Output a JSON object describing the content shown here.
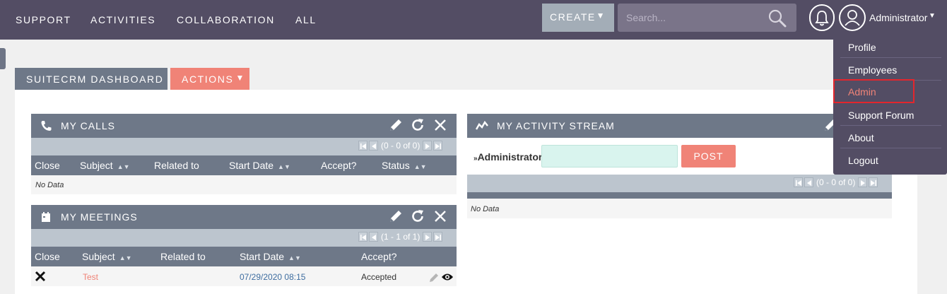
{
  "nav": {
    "items": [
      "SUPPORT",
      "ACTIVITIES",
      "COLLABORATION",
      "ALL"
    ],
    "create_label": "CREATE",
    "search_placeholder": "Search...",
    "user_name": "Administrator"
  },
  "dashboard": {
    "tab_label": "SUITECRM DASHBOARD",
    "actions_label": "ACTIONS"
  },
  "my_calls": {
    "title": "MY CALLS",
    "pager": "(0 - 0 of 0)",
    "columns": [
      "Close",
      "Subject",
      "Related to",
      "Start Date",
      "Accept?",
      "Status"
    ],
    "no_data": "No Data"
  },
  "my_meetings": {
    "title": "MY MEETINGS",
    "pager": "(1 - 1 of 1)",
    "columns": [
      "Close",
      "Subject",
      "Related to",
      "Start Date",
      "Accept?"
    ],
    "rows": [
      {
        "subject": "Test",
        "related_to": "",
        "start_date": "07/29/2020 08:15",
        "accept": "Accepted"
      }
    ]
  },
  "activity_stream": {
    "title": "MY ACTIVITY STREAM",
    "user": "Administrator",
    "post_label": "POST",
    "pager": "(0 - 0 of 0)",
    "no_data": "No Data"
  },
  "user_menu": {
    "items": [
      "Profile",
      "Employees",
      "Admin",
      "Support Forum",
      "About",
      "Logout"
    ],
    "highlighted": "Admin"
  },
  "colors": {
    "topbar": "#534d64",
    "accent": "#f08377",
    "header": "#6e7888",
    "highlight_border": "#e3262d"
  }
}
